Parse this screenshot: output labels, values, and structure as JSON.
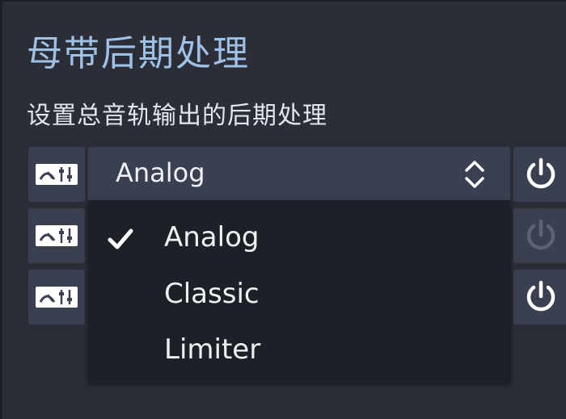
{
  "header": {
    "title": "母带后期处理",
    "subtitle": "设置总音轨输出的后期处理"
  },
  "rows": [
    {
      "icon": "mastering-settings-icon",
      "power_state": "on"
    },
    {
      "icon": "mastering-settings-icon",
      "power_state": "disabled"
    },
    {
      "icon": "mastering-settings-icon",
      "power_state": "on"
    }
  ],
  "select": {
    "value": "Analog",
    "options": [
      {
        "label": "Analog",
        "selected": true
      },
      {
        "label": "Classic",
        "selected": false
      },
      {
        "label": "Limiter",
        "selected": false
      }
    ]
  },
  "colors": {
    "background": "#2b2e37",
    "title": "#9fc1e6",
    "control": "#3a4050",
    "dropdown": "#1d2027"
  }
}
